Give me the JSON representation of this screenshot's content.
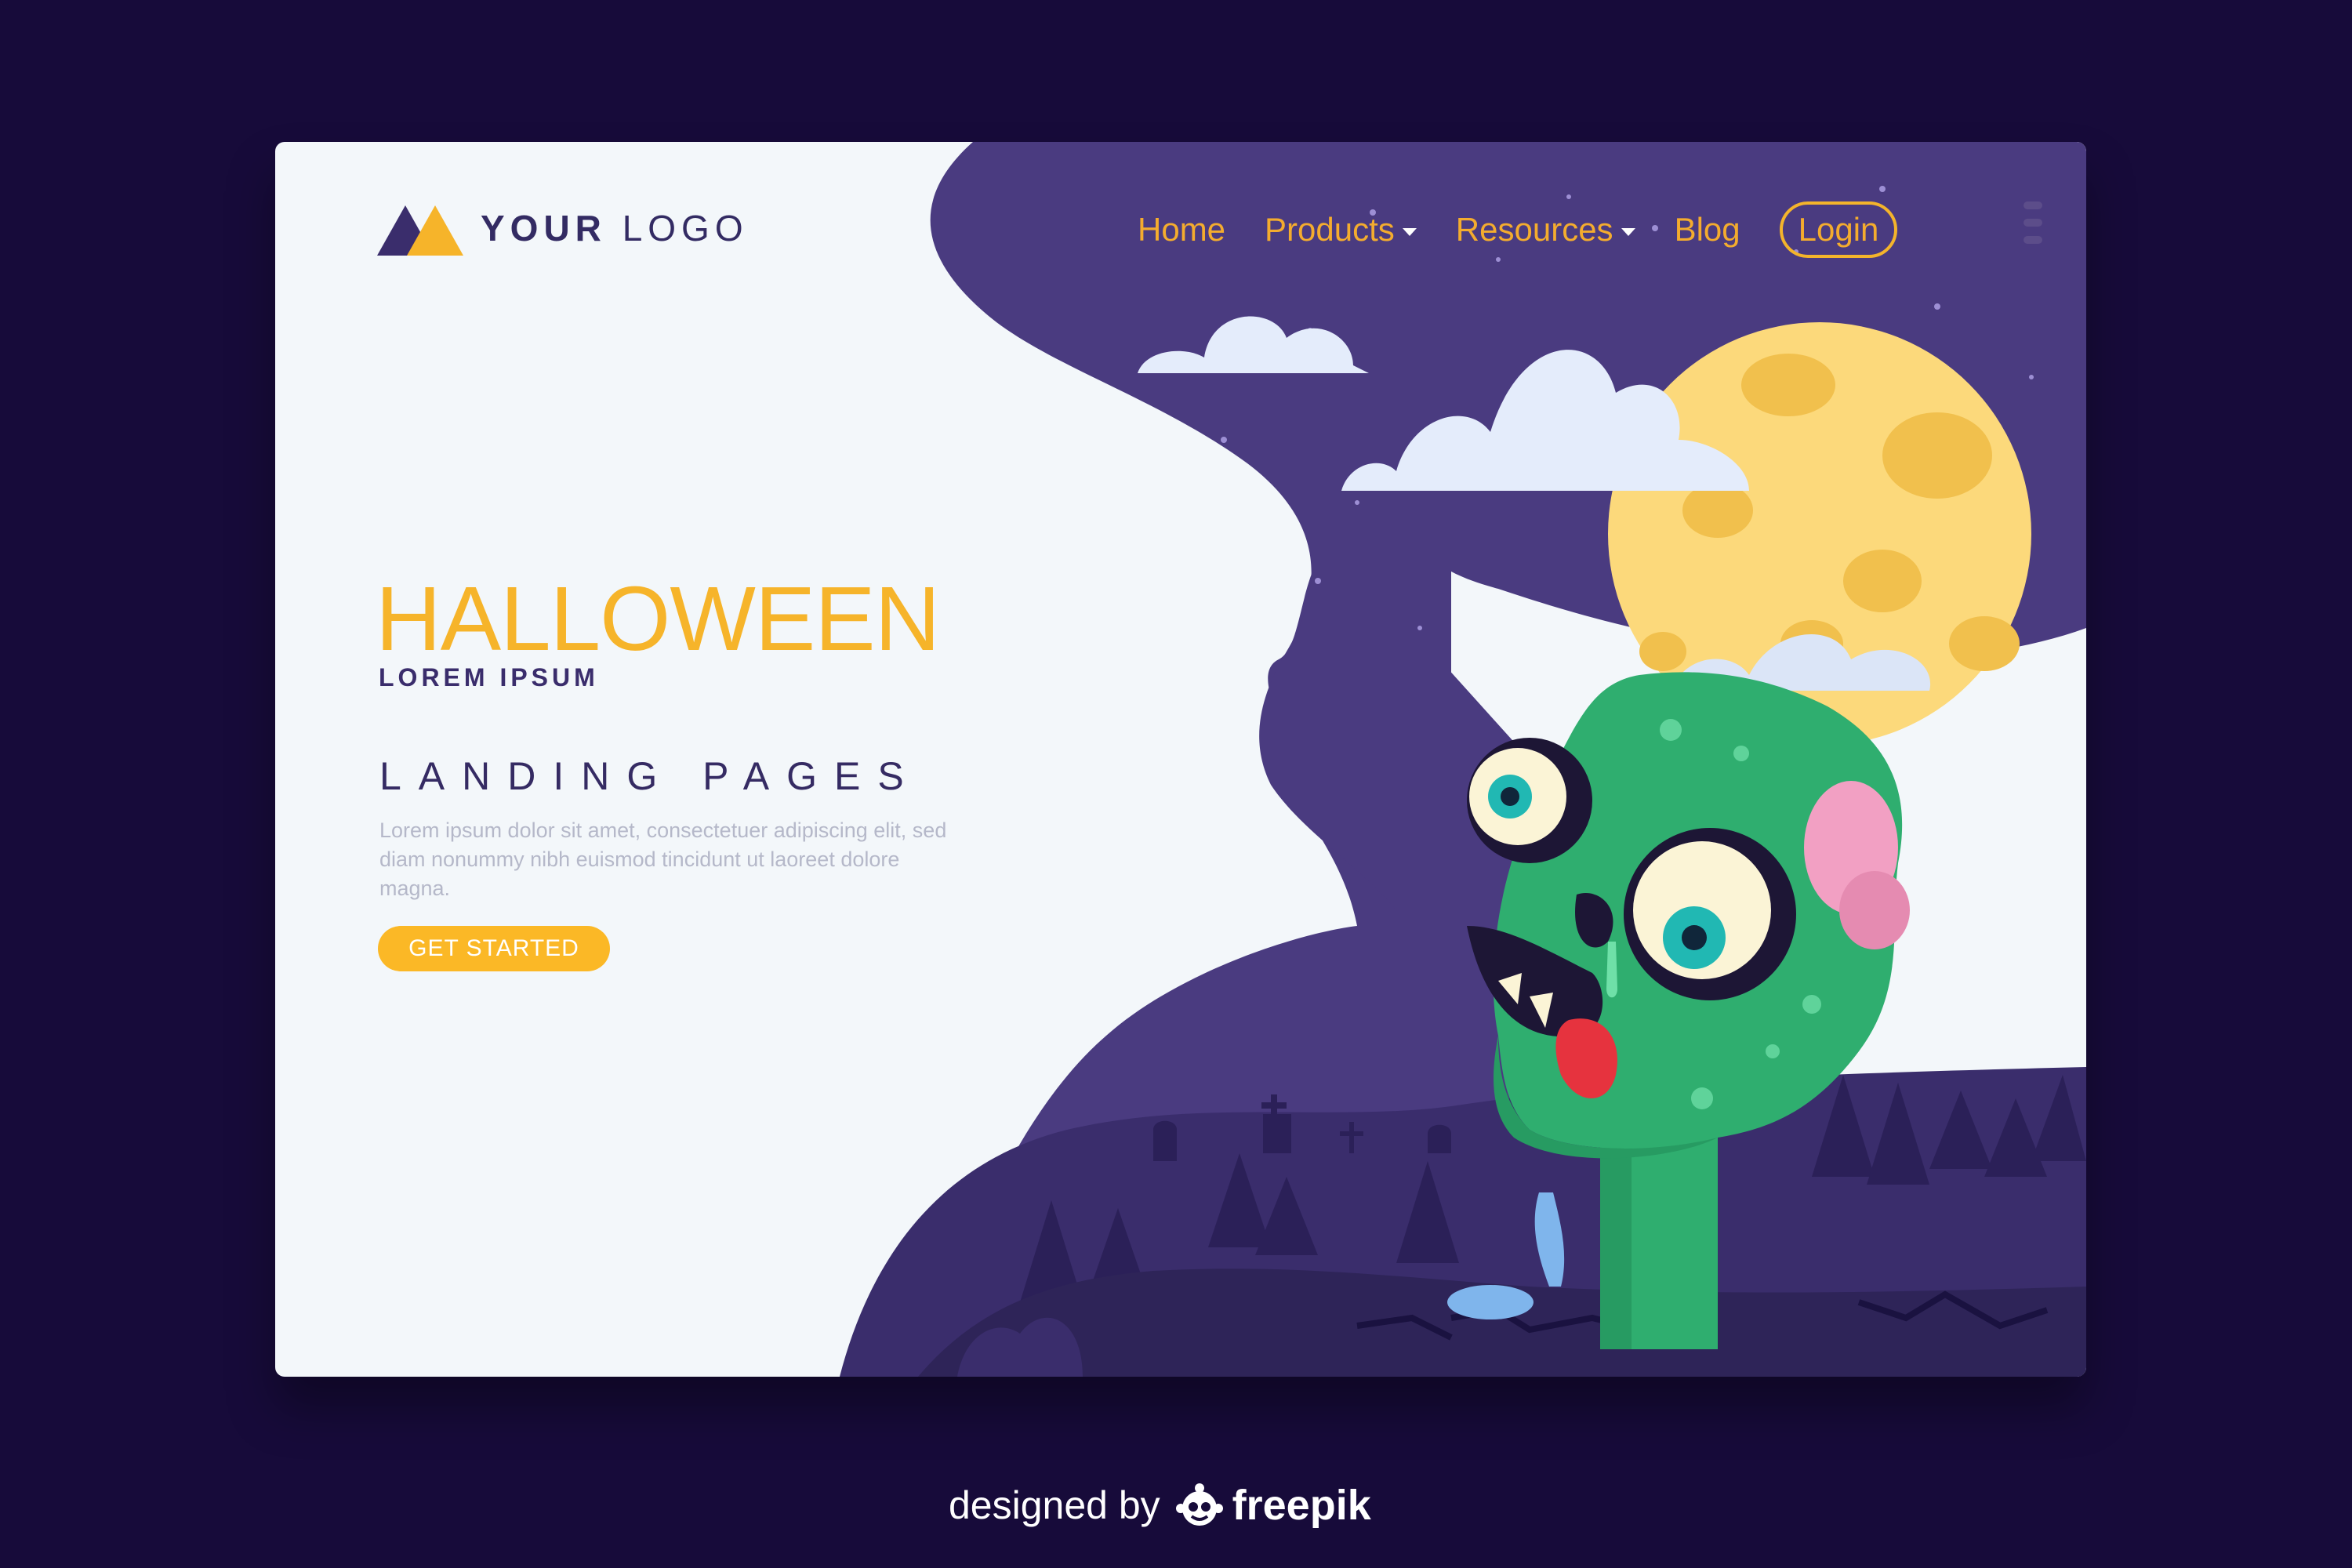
{
  "logo": {
    "text_bold": "YOUR",
    "text_light": "LOGO"
  },
  "nav": {
    "items": [
      {
        "label": "Home"
      },
      {
        "label": "Products"
      },
      {
        "label": "Resources"
      },
      {
        "label": "Blog"
      }
    ],
    "login_label": "Login"
  },
  "hero": {
    "title": "HALLOWEEN",
    "subtitle": "LOREM IPSUM",
    "heading": "LANDING PAGES",
    "body": "Lorem ipsum dolor sit amet, consectetuer adipiscing elit, sed diam nonummy nibh euismod tincidunt ut laoreet dolore magna.",
    "cta_label": "GET STARTED"
  },
  "credit": {
    "prefix": "designed by",
    "brand": "freepik"
  },
  "icons": {
    "logo": "mountain-logo-icon",
    "menu": "kebab-menu-icon",
    "freepik": "freepik-logo-icon"
  },
  "colors": {
    "page_background": "#170b3a",
    "card_background": "#f3f7fa",
    "night_sky": "#4a3b80",
    "accent_yellow": "#f6b42a",
    "moon": "#fcd97b",
    "zombie_green": "#2fae6f",
    "dark_text": "#352b63"
  }
}
